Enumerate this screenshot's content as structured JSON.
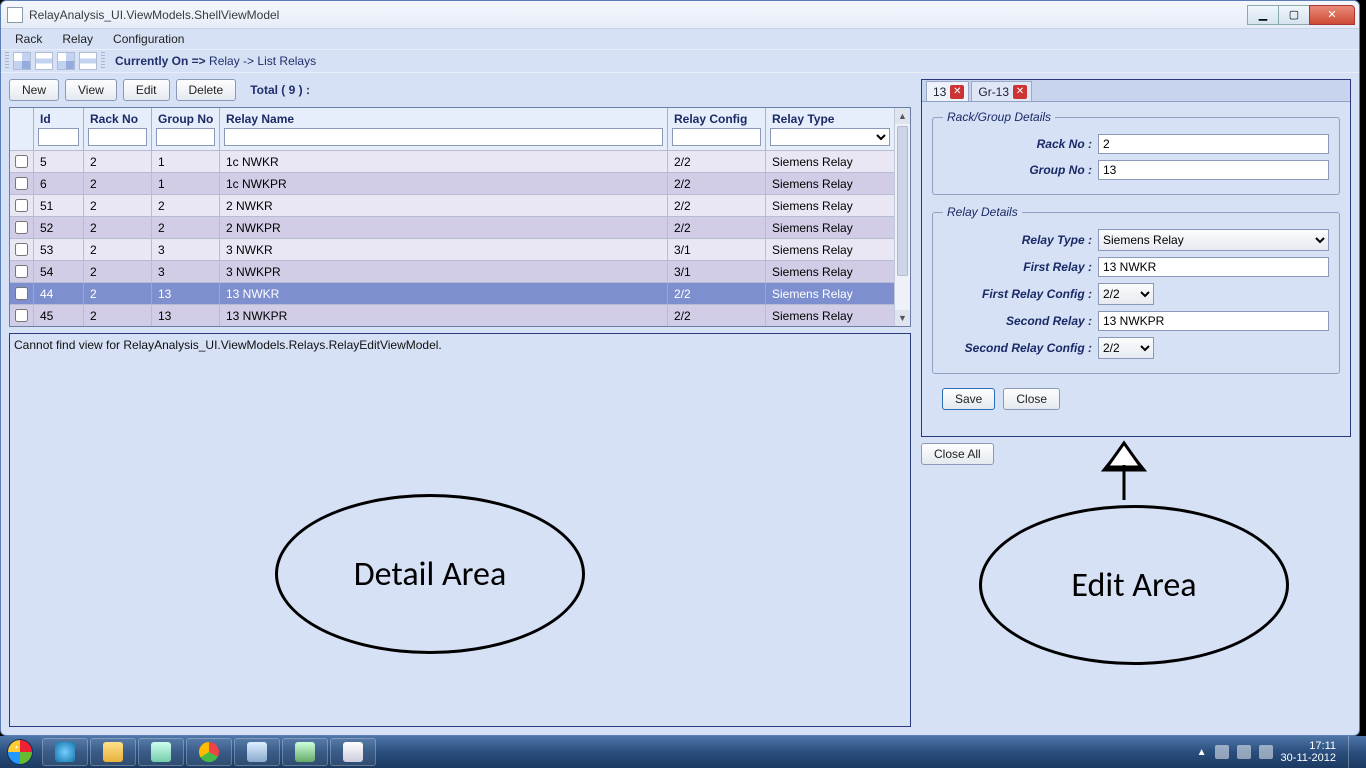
{
  "window": {
    "title": "RelayAnalysis_UI.ViewModels.ShellViewModel"
  },
  "menubar": {
    "items": [
      "Rack",
      "Relay",
      "Configuration"
    ]
  },
  "toolbar": {
    "breadcrumb_prefix": "Currently On =>",
    "breadcrumb_path": "Relay -> List Relays"
  },
  "list": {
    "buttons": {
      "new": "New",
      "view": "View",
      "edit": "Edit",
      "delete": "Delete"
    },
    "total_label": "Total ( 9 ) :",
    "columns": {
      "id": "Id",
      "rack": "Rack No",
      "group": "Group No",
      "name": "Relay Name",
      "config": "Relay Config",
      "type": "Relay Type"
    },
    "rows": [
      {
        "id": "5",
        "rack": "2",
        "group": "1",
        "name": "1c NWKR",
        "config": "2/2",
        "type": "Siemens Relay",
        "selected": false
      },
      {
        "id": "6",
        "rack": "2",
        "group": "1",
        "name": "1c NWKPR",
        "config": "2/2",
        "type": "Siemens Relay",
        "selected": false
      },
      {
        "id": "51",
        "rack": "2",
        "group": "2",
        "name": "2 NWKR",
        "config": "2/2",
        "type": "Siemens Relay",
        "selected": false
      },
      {
        "id": "52",
        "rack": "2",
        "group": "2",
        "name": "2 NWKPR",
        "config": "2/2",
        "type": "Siemens Relay",
        "selected": false
      },
      {
        "id": "53",
        "rack": "2",
        "group": "3",
        "name": "3 NWKR",
        "config": "3/1",
        "type": "Siemens Relay",
        "selected": false
      },
      {
        "id": "54",
        "rack": "2",
        "group": "3",
        "name": "3 NWKPR",
        "config": "3/1",
        "type": "Siemens Relay",
        "selected": false
      },
      {
        "id": "44",
        "rack": "2",
        "group": "13",
        "name": "13 NWKR",
        "config": "2/2",
        "type": "Siemens Relay",
        "selected": true
      },
      {
        "id": "45",
        "rack": "2",
        "group": "13",
        "name": "13 NWKPR",
        "config": "2/2",
        "type": "Siemens Relay",
        "selected": false
      }
    ]
  },
  "detail": {
    "message": "Cannot find view for RelayAnalysis_UI.ViewModels.Relays.RelayEditViewModel."
  },
  "edit": {
    "tabs": [
      {
        "label": "13"
      },
      {
        "label": "Gr-13"
      }
    ],
    "active_tab": 1,
    "rackgroup": {
      "legend": "Rack/Group Details",
      "rack_label": "Rack No :",
      "rack_value": "2",
      "group_label": "Group No :",
      "group_value": "13"
    },
    "relay": {
      "legend": "Relay Details",
      "type_label": "Relay Type :",
      "type_value": "Siemens Relay",
      "first_label": "First Relay :",
      "first_value": "13 NWKR",
      "firstcfg_label": "First Relay Config :",
      "firstcfg_value": "2/2",
      "second_label": "Second Relay :",
      "second_value": "13 NWKPR",
      "secondcfg_label": "Second Relay Config :",
      "secondcfg_value": "2/2"
    },
    "buttons": {
      "save": "Save",
      "close": "Close",
      "closeall": "Close All"
    }
  },
  "annotations": {
    "detail": "Detail Area",
    "edit": "Edit Area"
  },
  "tray": {
    "time": "17:11",
    "date": "30-11-2012"
  }
}
